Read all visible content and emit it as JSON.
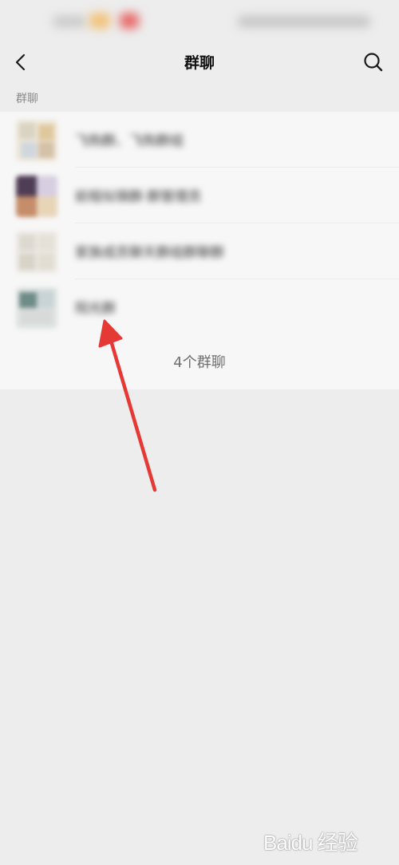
{
  "header": {
    "title": "群聊",
    "back_icon": "chevron-left-icon",
    "search_icon": "search-icon"
  },
  "section": {
    "label": "群聊"
  },
  "groups": [
    {
      "name": "飞购群、飞购群组"
    },
    {
      "name": "前程似锦群·群管理员"
    },
    {
      "name": "家族成员聊天群组群聊群"
    },
    {
      "name": "阳光群"
    }
  ],
  "footer": {
    "count_label": "4个群聊"
  },
  "watermark": {
    "text": "Baidu 经验"
  },
  "colors": {
    "background": "#ededed",
    "list_background": "#f7f7f7",
    "annotation_arrow": "#e53935"
  }
}
